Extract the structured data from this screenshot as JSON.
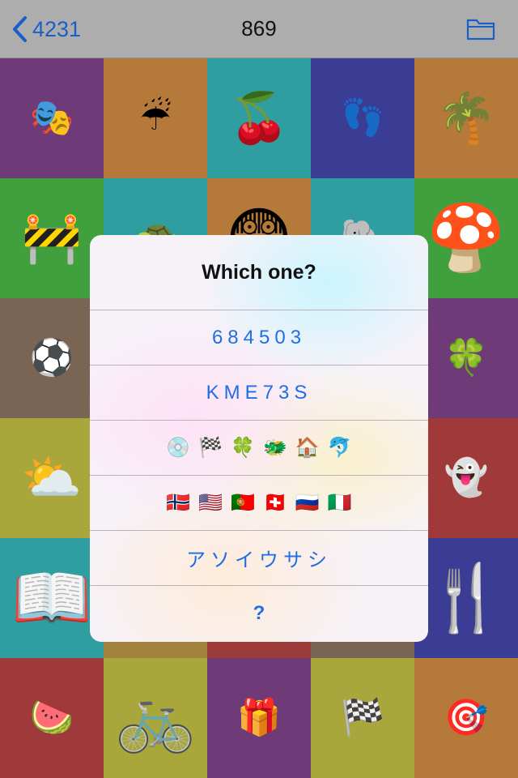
{
  "navbar": {
    "back_label": "4231",
    "title": "869",
    "accent": "#1a5fc7"
  },
  "grid": [
    {
      "emoji": "🎭",
      "bg": "#6e3a78"
    },
    {
      "emoji": "☔",
      "bg": "#b57a3a"
    },
    {
      "emoji": "🍒",
      "bg": "#2f9ea0",
      "size": "mid"
    },
    {
      "emoji": "👣",
      "bg": "#3b3c94"
    },
    {
      "emoji": "🌴",
      "bg": "#b57a3a",
      "size": "mid"
    },
    {
      "emoji": "🚧",
      "bg": "#3fa03d",
      "size": "mid"
    },
    {
      "emoji": "🐢",
      "bg": "#2f9ea0"
    },
    {
      "emoji": "😨",
      "bg": "#b57a3a",
      "size": "big"
    },
    {
      "emoji": "🐘",
      "bg": "#2f9ea0"
    },
    {
      "emoji": "🍄",
      "bg": "#3fa03d",
      "size": "big"
    },
    {
      "emoji": "⚽",
      "bg": "#7a6453"
    },
    {
      "emoji": "",
      "bg": "#9c3a3a"
    },
    {
      "emoji": "",
      "bg": "#9c3a3a"
    },
    {
      "emoji": "",
      "bg": "#9c3a3a"
    },
    {
      "emoji": "🍀",
      "bg": "#6e3a78"
    },
    {
      "emoji": "⛅",
      "bg": "#a9a63b",
      "size": "mid"
    },
    {
      "emoji": "",
      "bg": "#9c3a3a"
    },
    {
      "emoji": "",
      "bg": "#9c3a3a"
    },
    {
      "emoji": "",
      "bg": "#9c3a3a"
    },
    {
      "emoji": "👻",
      "bg": "#a03a3a"
    },
    {
      "emoji": "📖",
      "bg": "#2f9ea0",
      "size": "big"
    },
    {
      "emoji": "",
      "bg": "#a3813e"
    },
    {
      "emoji": "",
      "bg": "#9c3a3a"
    },
    {
      "emoji": "",
      "bg": "#7a6453"
    },
    {
      "emoji": "🍴",
      "bg": "#3b3c94",
      "size": "big"
    },
    {
      "emoji": "🍉",
      "bg": "#a03a3a"
    },
    {
      "emoji": "🚲",
      "bg": "#a9a63b",
      "size": "big"
    },
    {
      "emoji": "🎁",
      "bg": "#6e3a78"
    },
    {
      "emoji": "🏁",
      "bg": "#a9a63b"
    },
    {
      "emoji": "🎯",
      "bg": "#b57a3a"
    }
  ],
  "alert": {
    "title": "Which one?",
    "options": [
      {
        "label": "684503"
      },
      {
        "label": "KME73S"
      },
      {
        "emojis": [
          "💿",
          "🏁",
          "🍀",
          "🐲",
          "🏠",
          "🐬"
        ]
      },
      {
        "emojis": [
          "🇳🇴",
          "🇺🇸",
          "🇵🇹",
          "🇨🇭",
          "🇷🇺",
          "🇮🇹"
        ]
      },
      {
        "label": "アソイウサシ"
      },
      {
        "label": "?"
      }
    ],
    "option_color": "#1f6ee6"
  }
}
